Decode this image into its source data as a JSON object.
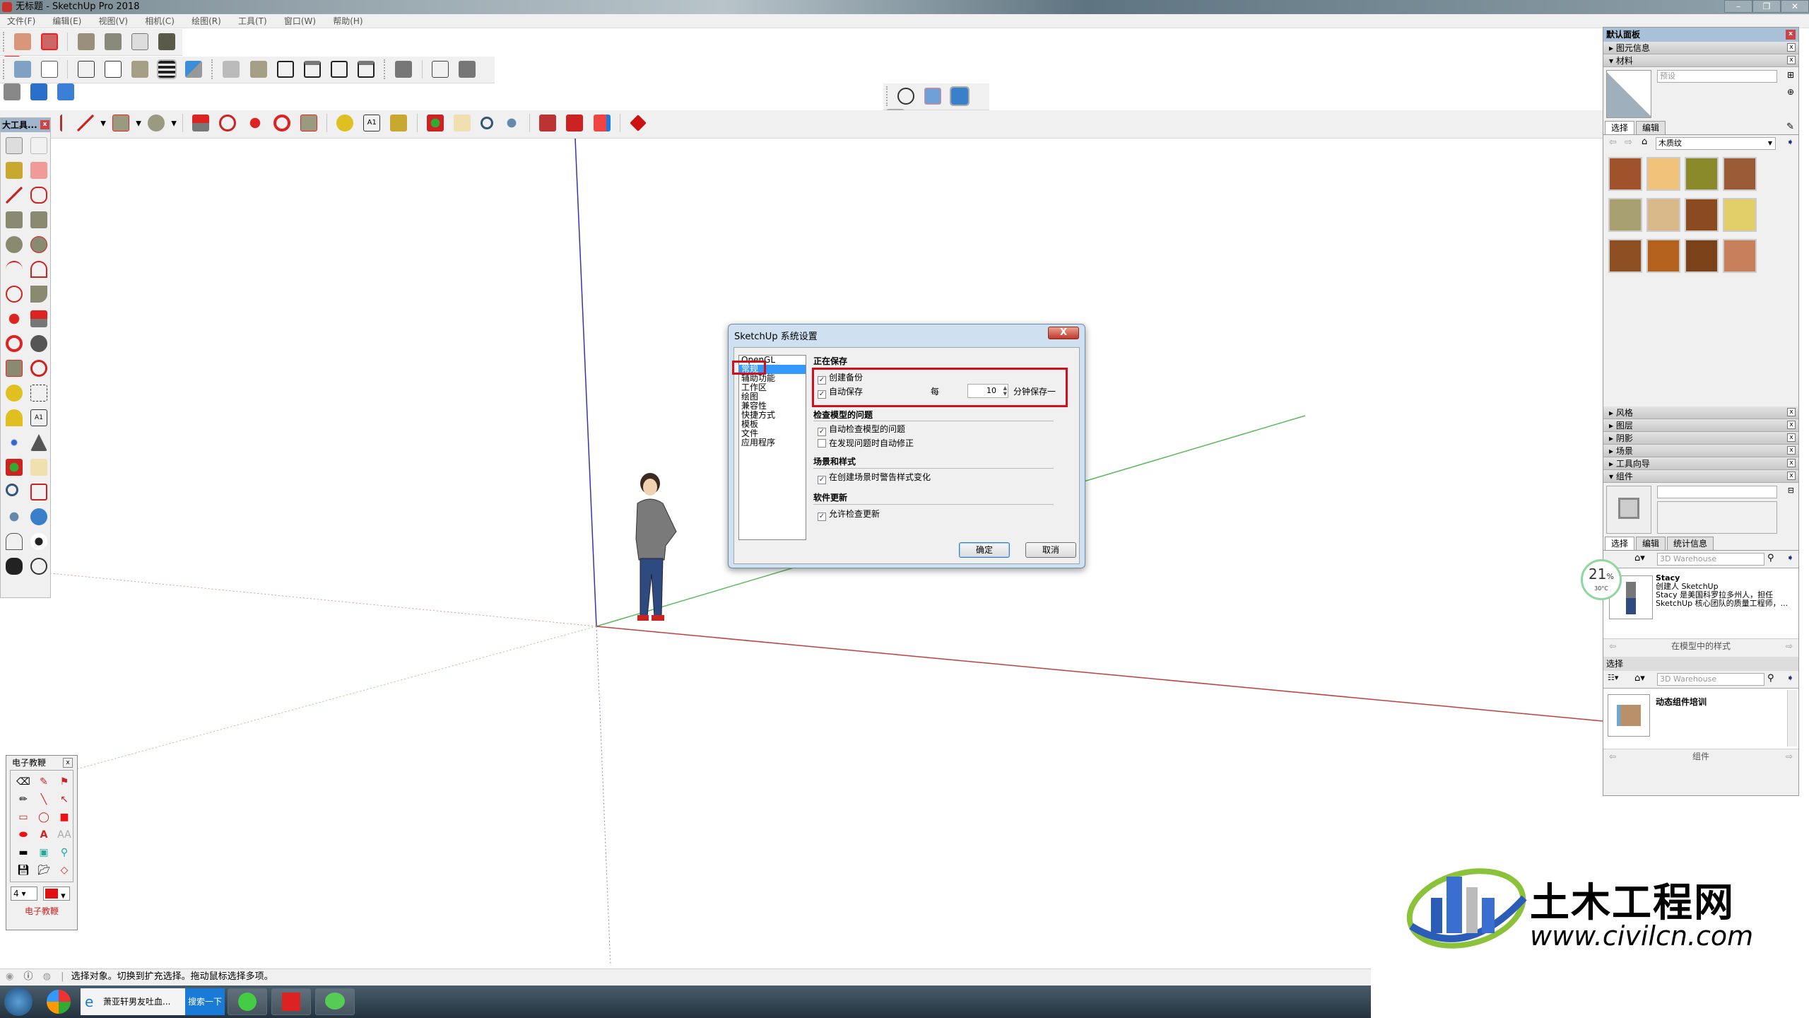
{
  "window": {
    "title": "无标题 - SketchUp Pro 2018",
    "minimize": "–",
    "restore": "❐",
    "close": "✕"
  },
  "menu": [
    "文件(F)",
    "编辑(E)",
    "视图(V)",
    "相机(C)",
    "绘图(R)",
    "工具(T)",
    "窗口(W)",
    "帮助(H)"
  ],
  "toolbars": {
    "row1_icons": [
      "sandbox-from-contours-icon",
      "sandbox-from-scratch-icon",
      "smoove-icon",
      "stamp-icon",
      "drape-icon",
      "add-detail-icon",
      "flip-edge-icon"
    ],
    "row2_icons": [
      "xray-icon",
      "back-edges-icon",
      "wireframe-icon",
      "hidden-line-icon",
      "shaded-icon",
      "shaded-textures-icon",
      "monochrome-icon",
      "iso-view-icon",
      "top-view-icon",
      "front-view-icon",
      "right-view-icon",
      "back-view-icon",
      "left-view-icon",
      "outer-shell-icon",
      "intersect-icon",
      "union-icon",
      "subtract-icon",
      "trim-icon",
      "split-icon"
    ],
    "row3_icons": [
      "select-icon",
      "eraser-icon",
      "pencil-icon",
      "arc-icon",
      "circle-icon",
      "push-pull-icon",
      "follow-me-icon",
      "move-icon",
      "rotate-icon",
      "scale-icon",
      "tape-measure-icon",
      "text-icon",
      "paint-bucket-icon",
      "orbit-icon",
      "pan-icon",
      "zoom-icon",
      "zoom-extents-icon",
      "3d-warehouse-icon",
      "extension-warehouse-icon",
      "send-to-layout-icon",
      "extension-manager-icon"
    ],
    "section_icons": [
      "section-plane-icon",
      "display-section-planes-icon",
      "display-section-cuts-icon",
      "display-section-fill-icon"
    ]
  },
  "large_toolset": {
    "title": "大工具...",
    "close": "x"
  },
  "dialog": {
    "title": "SketchUp 系统设置",
    "close": "X",
    "nav": [
      "OpenGL",
      "常规",
      "辅助功能",
      "工作区",
      "绘图",
      "兼容性",
      "快捷方式",
      "模板",
      "文件",
      "应用程序"
    ],
    "selected": "常规",
    "sections": {
      "saving": "正在保存",
      "check_model": "检查模型的问题",
      "scenes": "场景和样式",
      "updates": "软件更新"
    },
    "options": {
      "create_backup": {
        "label": "创建备份",
        "checked": true
      },
      "auto_save": {
        "label": "自动保存",
        "checked": true
      },
      "every": "每",
      "minutes_value": "10",
      "minutes_suffix": "分钟保存一",
      "auto_check": {
        "label": "自动检查模型的问题",
        "checked": true
      },
      "auto_fix": {
        "label": "在发现问题时自动修正",
        "checked": false
      },
      "scene_warn": {
        "label": "在创建场景时警告样式变化",
        "checked": true
      },
      "allow_update": {
        "label": "允许检查更新",
        "checked": true
      }
    },
    "ok": "确定",
    "cancel": "取消",
    "check_glyph": "✓"
  },
  "tray": {
    "title": "默认面板",
    "entity_info": "图元信息",
    "materials": "材料",
    "material_name_placeholder": "预设",
    "tab_select": "选择",
    "tab_edit": "编辑",
    "collection": "木质纹",
    "swatch_colors": [
      "#a0522d",
      "#f0c27a",
      "#8a8a2a",
      "#9a5a35",
      "#a8a070",
      "#d9b989",
      "#8b4a20",
      "#e2cf6a",
      "#8e4f22",
      "#b5611e",
      "#7b4219",
      "#c8805c"
    ],
    "styles": "风格",
    "layers": "图层",
    "shadows": "阴影",
    "scenes": "场景",
    "instructor": "工具向导",
    "components": "组件",
    "tab_stats": "统计信息",
    "search_placeholder": "3D Warehouse",
    "component_name": "Stacy",
    "component_author": "创建人 SketchUp",
    "component_desc1": "Stacy 是美国科罗拉多州人，担任",
    "component_desc2": "SketchUp 核心团队的质量工程师，...",
    "in_model": "在模型中的样式",
    "select2": "选择",
    "folder_name": "动态组件培训",
    "components_footer": "组件"
  },
  "gauge": {
    "percent": "21",
    "unit": "%",
    "temp": "30°C"
  },
  "tutor": {
    "title": "电子教鞭",
    "footer": "电子教鞭",
    "size_value": "4",
    "color": "#e01010"
  },
  "status": {
    "text": "选择对象。切换到扩充选择。拖动鼠标选择多项。"
  },
  "taskbar": {
    "ie_text": "萧亚轩男友吐血...",
    "search_btn": "搜索一下"
  },
  "watermark": {
    "name": "土木工程网",
    "url": "www.civilcn.com"
  },
  "colors": {
    "accent": "#3399ff",
    "highlight_red": "#d0111b",
    "axis_red": "#c04040",
    "axis_green": "#5cb85c",
    "axis_blue": "#3333aa"
  }
}
